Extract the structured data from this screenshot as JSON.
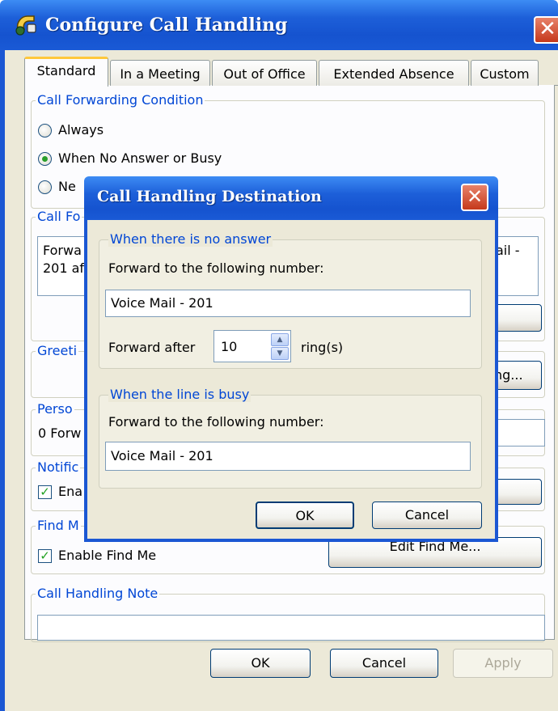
{
  "window": {
    "title": "Configure Call Handling",
    "close_glyph": "✕",
    "icon": "call-handling-app-icon"
  },
  "tabs": [
    {
      "label": "Standard",
      "active": true
    },
    {
      "label": "In a Meeting",
      "active": false
    },
    {
      "label": "Out of Office",
      "active": false
    },
    {
      "label": "Extended Absence",
      "active": false
    },
    {
      "label": "Custom",
      "active": false
    }
  ],
  "condition": {
    "legend": "Call Forwarding Condition",
    "options": [
      {
        "label": "Always",
        "selected": false
      },
      {
        "label": "When No Answer or Busy",
        "selected": true
      },
      {
        "label": "Ne",
        "selected": false
      }
    ]
  },
  "forwarding": {
    "legend": "Call Fo",
    "summary_line1": "Forwa",
    "summary_line2": "201 af",
    "summary_right": "ail -"
  },
  "greeting": {
    "legend": "Greeti",
    "button_label": "ng..."
  },
  "personal": {
    "legend": "Perso",
    "text": "0 Forw"
  },
  "notification": {
    "legend": "Notific",
    "checkbox_label": "Ena",
    "checked": true
  },
  "findme": {
    "legend": "Find M",
    "checkbox_label": "Enable Find Me",
    "checked": true,
    "edit_button": "Edit Find Me..."
  },
  "note": {
    "legend": "Call Handling Note",
    "value": ""
  },
  "footer": {
    "ok": "OK",
    "cancel": "Cancel",
    "apply": "Apply"
  },
  "dialog": {
    "title": "Call Handling Destination",
    "close_glyph": "✕",
    "no_answer": {
      "legend": "When there is no answer",
      "forward_label": "Forward to the following number:",
      "number": "Voice Mail - 201",
      "after_label": "Forward after",
      "rings": "10",
      "rings_unit": "ring(s)"
    },
    "busy": {
      "legend": "When the line is busy",
      "forward_label": "Forward to the following number:",
      "number": "Voice Mail - 201"
    },
    "ok": "OK",
    "cancel": "Cancel"
  },
  "colors": {
    "titlebar": "#1d5fd9",
    "legend_text": "#0046d5",
    "dialog_face": "#ece9d8",
    "active_tab_accent": "#ffc83c"
  }
}
